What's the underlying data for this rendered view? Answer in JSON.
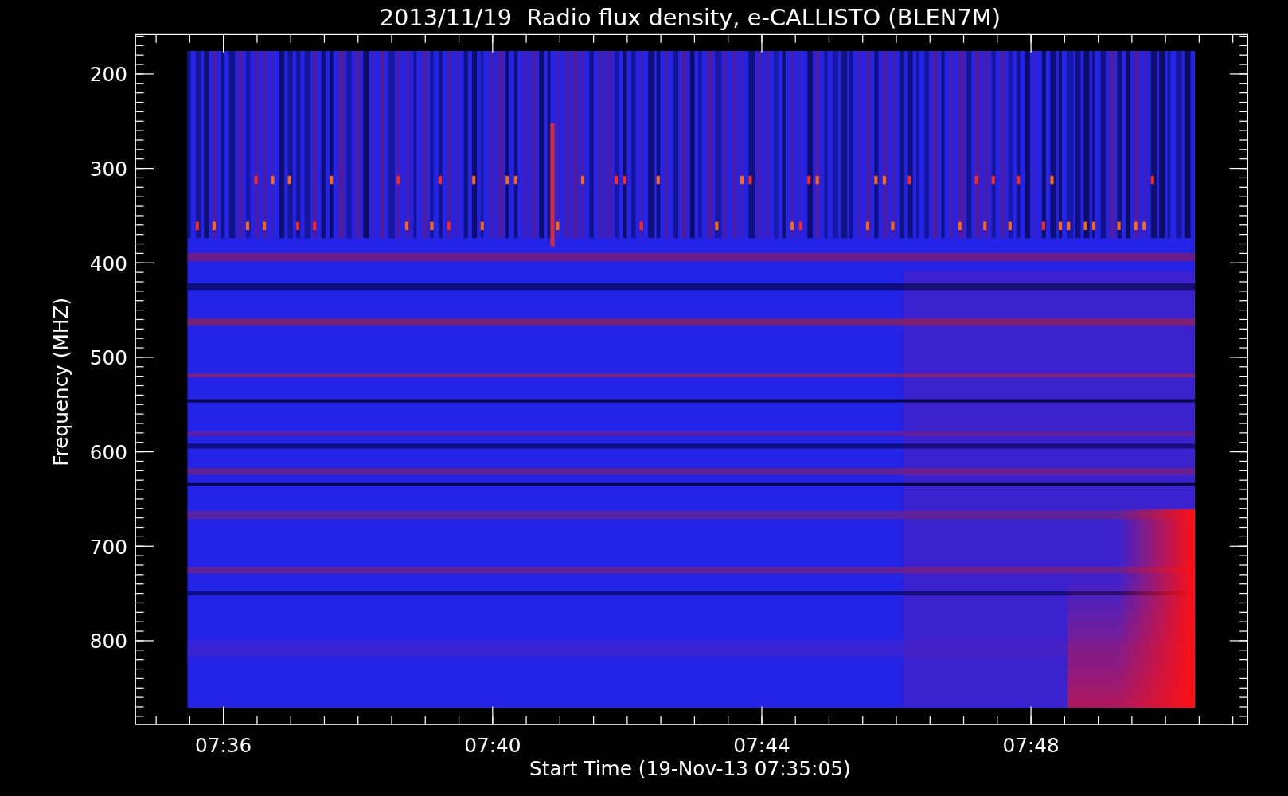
{
  "title": "2013/11/19  Radio flux density, e-CALLISTO (BLEN7M)",
  "y_axis": {
    "label": "Frequency (MHZ)",
    "ticks": [
      "200",
      "300",
      "400",
      "500",
      "600",
      "700",
      "800"
    ]
  },
  "x_axis": {
    "label": "Start Time (19-Nov-13 07:35:05)",
    "ticks": [
      "07:36",
      "07:40",
      "07:44",
      "07:48"
    ]
  }
}
